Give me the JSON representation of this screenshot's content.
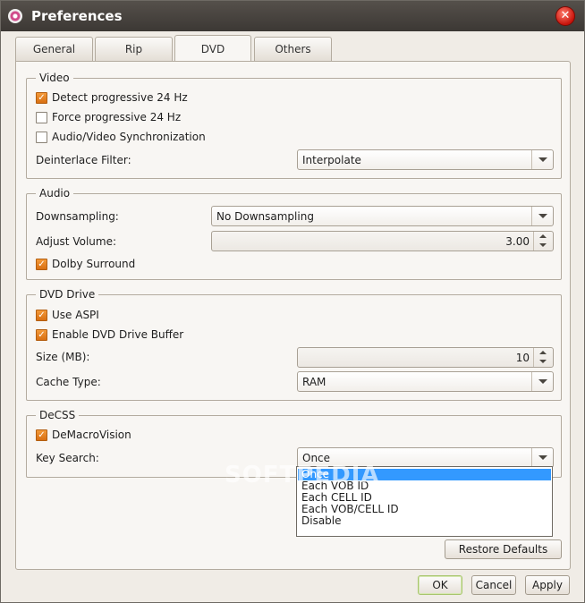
{
  "window": {
    "title": "Preferences"
  },
  "tabs": [
    {
      "label": "General"
    },
    {
      "label": "Rip"
    },
    {
      "label": "DVD"
    },
    {
      "label": "Others"
    }
  ],
  "active_tab": "DVD",
  "video": {
    "title": "Video",
    "detect_progressive": {
      "label": "Detect progressive 24 Hz",
      "checked": true
    },
    "force_progressive": {
      "label": "Force progressive 24 Hz",
      "checked": false
    },
    "av_sync": {
      "label": "Audio/Video Synchronization",
      "checked": false
    },
    "deinterlace_label": "Deinterlace Filter:",
    "deinterlace_value": "Interpolate"
  },
  "audio": {
    "title": "Audio",
    "downsampling_label": "Downsampling:",
    "downsampling_value": "No Downsampling",
    "volume_label": "Adjust Volume:",
    "volume_value": "3.00",
    "dolby": {
      "label": "Dolby Surround",
      "checked": true
    }
  },
  "dvd_drive": {
    "title": "DVD Drive",
    "use_aspi": {
      "label": "Use ASPI",
      "checked": true
    },
    "drive_buffer": {
      "label": "Enable DVD Drive Buffer",
      "checked": true
    },
    "size_label": "Size (MB):",
    "size_value": "10",
    "cache_label": "Cache Type:",
    "cache_value": "RAM"
  },
  "decss": {
    "title": "DeCSS",
    "demacrovision": {
      "label": "DeMacroVision",
      "checked": true
    },
    "key_search_label": "Key Search:",
    "key_search_value": "Once",
    "key_search_options": [
      "Once",
      "Each VOB ID",
      "Each CELL ID",
      "Each VOB/CELL ID",
      "Disable"
    ],
    "selected_option_index": 0
  },
  "watermark": "SOFTPEDIA",
  "buttons": {
    "restore_defaults": "Restore Defaults",
    "ok": "OK",
    "cancel": "Cancel",
    "apply": "Apply"
  },
  "colors": {
    "titlebar": "#3c3834",
    "checkbox_checked": "#e3821f",
    "selection": "#3399ff",
    "close_button": "#c8140c"
  },
  "icons": {
    "app": "dvd-disc-icon",
    "close": "close-icon"
  }
}
